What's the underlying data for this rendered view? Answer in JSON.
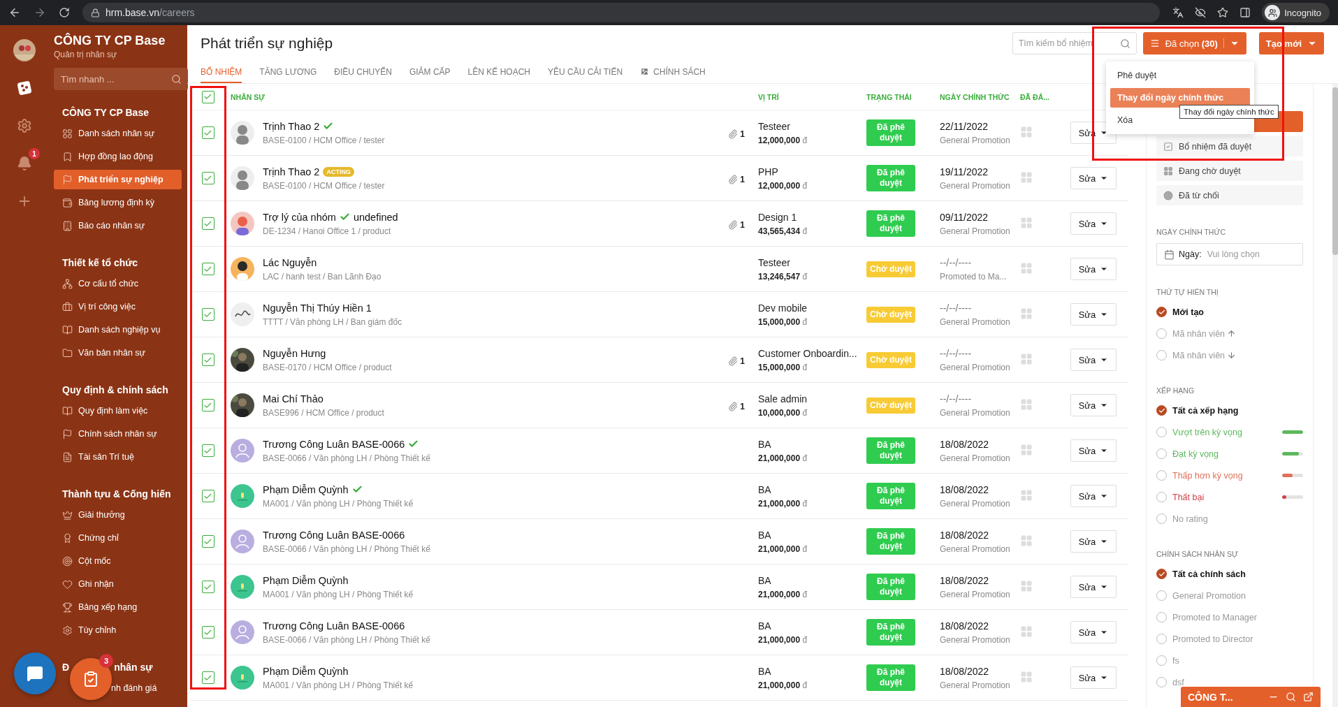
{
  "browser": {
    "url_host": "hrm.base.vn",
    "url_path": "/careers",
    "profile": "Incognito"
  },
  "rail": {
    "notification_count": "1"
  },
  "sidebar": {
    "company": "CÔNG TY CP Base",
    "subtitle": "Quản trị nhân sự",
    "search": {
      "placeholder": "Tìm nhanh ..."
    },
    "sections": [
      {
        "title": "CÔNG TY CP Base",
        "items": [
          {
            "label": "Danh sách nhân sự",
            "selected": false
          },
          {
            "label": "Hợp đồng lao động",
            "selected": false
          },
          {
            "label": "Phát triển sự nghiệp",
            "selected": true
          },
          {
            "label": "Bảng lương định kỳ",
            "selected": false
          },
          {
            "label": "Báo cáo nhân sự",
            "selected": false
          }
        ]
      },
      {
        "title": "Thiết kế tổ chức",
        "items": [
          {
            "label": "Cơ cấu tổ chức",
            "selected": false
          },
          {
            "label": "Vị trí công việc",
            "selected": false
          },
          {
            "label": "Danh sách nghiệp vụ",
            "selected": false
          },
          {
            "label": "Văn bản nhân sự",
            "selected": false
          }
        ]
      },
      {
        "title": "Quy định & chính sách",
        "items": [
          {
            "label": "Quy định làm việc",
            "selected": false
          },
          {
            "label": "Chính sách nhân sự",
            "selected": false
          },
          {
            "label": "Tài sản Trí tuệ",
            "selected": false
          }
        ]
      },
      {
        "title": "Thành tựu & Cống hiến",
        "items": [
          {
            "label": "Giải thưởng",
            "selected": false
          },
          {
            "label": "Chứng chỉ",
            "selected": false
          },
          {
            "label": "Cột mốc",
            "selected": false
          },
          {
            "label": "Ghi nhận",
            "selected": false
          },
          {
            "label": "Bảng xếp hạng",
            "selected": false
          },
          {
            "label": "Tùy chỉnh",
            "selected": false
          }
        ]
      },
      {
        "title": "Đ",
        "title_tail": "nhân sự",
        "items": [
          {
            "label": "nh đánh giá",
            "selected": false
          }
        ]
      }
    ]
  },
  "floating": {
    "task_count": "3"
  },
  "page": {
    "title": "Phát triển sự nghiệp",
    "search": {
      "placeholder": "Tìm kiếm bổ nhiệm"
    },
    "selected_button": "Đã chọn **(30)**",
    "create_button": "Tạo mới"
  },
  "tabs": [
    {
      "label": "BỔ NHIỆM",
      "selected": true,
      "kind": "text"
    },
    {
      "label": "TĂNG LƯƠNG",
      "selected": false,
      "kind": "text"
    },
    {
      "label": "ĐIỀU CHUYỂN",
      "selected": false,
      "kind": "text"
    },
    {
      "label": "GIẢM CẤP",
      "selected": false,
      "kind": "text"
    },
    {
      "label": "LÊN KẾ HOẠCH",
      "selected": false,
      "kind": "text"
    },
    {
      "label": "YÊU CẦU CẢI TIẾN",
      "selected": false,
      "kind": "text"
    },
    {
      "label": "CHÍNH SÁCH",
      "selected": false,
      "kind": "icon"
    }
  ],
  "dropdown": {
    "items": [
      {
        "label": "Phê duyệt",
        "selected": false
      },
      {
        "label": "Thay đổi ngày chính thức",
        "selected": true
      },
      {
        "label": "Xóa",
        "selected": false
      }
    ],
    "tooltip": "Thay đổi ngày chính thức"
  },
  "table": {
    "all_checked": true,
    "columns": [
      "NHÂN SỰ",
      "VỊ TRÍ",
      "TRẠNG THÁI",
      "NGÀY CHÍNH THỨC",
      "ĐÃ ĐÁ..."
    ],
    "rows": [
      {
        "checked": true,
        "avatar": {
          "kind": "silhouette"
        },
        "name": "Trịnh Thao 2",
        "verified": true,
        "details": "BASE-0100 / HCM Office / tester",
        "attachments": "1",
        "position": "Testeer",
        "salary": "12,000,000",
        "currency": "đ",
        "status": {
          "kind": "approved",
          "label": "Đã phê duyệt"
        },
        "date": "22/11/2022",
        "policy": "General Promotion",
        "action": "Sửa"
      },
      {
        "checked": true,
        "avatar": {
          "kind": "silhouette"
        },
        "name": "Trịnh Thao 2",
        "verified": false,
        "badge": "ACTING",
        "details": "BASE-0100 / HCM Office / tester",
        "attachments": "1",
        "position": "PHP",
        "salary": "12,000,000",
        "currency": "đ",
        "status": {
          "kind": "approved",
          "label": "Đã phê duyệt"
        },
        "date": "19/11/2022",
        "policy": "General Promotion",
        "action": "Sửa"
      },
      {
        "checked": true,
        "avatar": {
          "kind": "illustration"
        },
        "name": "Trợ lý của nhóm",
        "verified": true,
        "suffix": "undefined",
        "details": "DE-1234 / Hanoi Office 1 / product",
        "attachments": "1",
        "position": "Design 1",
        "salary": "43,565,434",
        "currency": "đ",
        "status": {
          "kind": "approved",
          "label": "Đã phê duyệt"
        },
        "date": "09/11/2022",
        "policy": "General Promotion",
        "action": "Sửa"
      },
      {
        "checked": true,
        "avatar": {
          "kind": "cartoon"
        },
        "name": "Lác Nguyễn",
        "verified": false,
        "details": "LAC / hanh test / Ban Lãnh Đạo",
        "position": "Testeer",
        "salary": "13,246,547",
        "currency": "đ",
        "status": {
          "kind": "pending",
          "label": "Chờ duyệt"
        },
        "date": "--/--/----",
        "policy": "Promoted to Ma...",
        "action": "Sửa"
      },
      {
        "checked": true,
        "avatar": {
          "kind": "signature"
        },
        "name": "Nguyễn Thị Thúy Hiền 1",
        "verified": false,
        "details": "TTTT / Văn phòng LH / Ban giám đốc",
        "position": "Dev mobile",
        "salary": "15,000,000",
        "currency": "đ",
        "status": {
          "kind": "pending",
          "label": "Chờ duyệt"
        },
        "date": "--/--/----",
        "policy": "General Promotion",
        "action": "Sửa"
      },
      {
        "checked": true,
        "name": "Nguyễn Hưng",
        "verified": false,
        "details": "BASE-0170 / HCM Office / product",
        "attachments": "1",
        "position": "Customer Onboardin...",
        "salary": "15,000,000",
        "currency": "đ",
        "status": {
          "kind": "pending",
          "label": "Chờ duyệt"
        },
        "date": "--/--/----",
        "policy": "General Promotion",
        "action": "Sửa"
      },
      {
        "checked": true,
        "name": "Mai Chí Thảo",
        "verified": false,
        "details": "BASE996 / HCM Office / product",
        "attachments": "1",
        "position": "Sale admin",
        "salary": "10,000,000",
        "currency": "đ",
        "status": {
          "kind": "pending",
          "label": "Chờ duyệt"
        },
        "date": "--/--/----",
        "policy": "General Promotion",
        "action": "Sửa"
      },
      {
        "checked": true,
        "avatar": {
          "kind": "placeholder"
        },
        "name": "Trương Công Luân BASE-0066",
        "verified": true,
        "details": "BASE-0066 / Văn phòng LH / Phòng Thiết kế",
        "position": "BA",
        "salary": "21,000,000",
        "currency": "đ",
        "status": {
          "kind": "approved",
          "label": "Đã phê duyệt"
        },
        "date": "18/08/2022",
        "policy": "General Promotion",
        "action": "Sửa"
      },
      {
        "checked": true,
        "avatar": {
          "kind": "logo"
        },
        "name": "Phạm Diễm Quỳnh",
        "verified": true,
        "details": "MA001 / Văn phòng LH / Phòng Thiết kế",
        "position": "BA",
        "salary": "21,000,000",
        "currency": "đ",
        "status": {
          "kind": "approved",
          "label": "Đã phê duyệt"
        },
        "date": "18/08/2022",
        "policy": "General Promotion",
        "action": "Sửa"
      },
      {
        "checked": true,
        "avatar": {
          "kind": "placeholder"
        },
        "name": "Trương Công Luân BASE-0066",
        "verified": false,
        "details": "BASE-0066 / Văn phòng LH / Phòng Thiết kế",
        "position": "BA",
        "salary": "21,000,000",
        "currency": "đ",
        "status": {
          "kind": "approved",
          "label": "Đã phê duyệt"
        },
        "date": "18/08/2022",
        "policy": "General Promotion",
        "action": "Sửa"
      },
      {
        "checked": true,
        "avatar": {
          "kind": "logo"
        },
        "name": "Phạm Diễm Quỳnh",
        "verified": false,
        "details": "MA001 / Văn phòng LH / Phòng Thiết kế",
        "position": "BA",
        "salary": "21,000,000",
        "currency": "đ",
        "status": {
          "kind": "approved",
          "label": "Đã phê duyệt"
        },
        "date": "18/08/2022",
        "policy": "General Promotion",
        "action": "Sửa"
      },
      {
        "checked": true,
        "avatar": {
          "kind": "placeholder"
        },
        "name": "Trương Công Luân BASE-0066",
        "verified": false,
        "details": "BASE-0066 / Văn phòng LH / Phòng Thiết kế",
        "position": "BA",
        "salary": "21,000,000",
        "currency": "đ",
        "status": {
          "kind": "approved",
          "label": "Đã phê duyệt"
        },
        "date": "18/08/2022",
        "policy": "General Promotion",
        "action": "Sửa"
      },
      {
        "checked": true,
        "avatar": {
          "kind": "logo"
        },
        "name": "Phạm Diễm Quỳnh",
        "verified": false,
        "details": "MA001 / Văn phòng LH / Phòng Thiết kế",
        "position": "BA",
        "salary": "21,000,000",
        "currency": "đ",
        "status": {
          "kind": "approved",
          "label": "Đã phê duyệt"
        },
        "date": "18/08/2022",
        "policy": "General Promotion",
        "action": "Sửa"
      }
    ]
  },
  "filters": {
    "status_items": [
      {
        "label": "Bổ nhiệm đã duyệt",
        "kind": "approved"
      },
      {
        "label": "Đang chờ duyệt",
        "kind": "pending"
      },
      {
        "label": "Đã từ chối",
        "kind": "rejected"
      }
    ],
    "date": {
      "title": "NGÀY CHÍNH THỨC",
      "label": "Ngày:",
      "placeholder": "Vui lòng chọn"
    },
    "order": {
      "title": "THỨ TỰ HIỂN THỊ",
      "options": [
        {
          "label": "Mới tạo",
          "selected": true,
          "kind": "plain"
        },
        {
          "label": "Mã nhân viên",
          "selected": false,
          "kind": "ascending"
        },
        {
          "label": "Mã nhân viên",
          "selected": false,
          "kind": "descending"
        }
      ]
    },
    "rating": {
      "title": "XẾP HẠNG",
      "options": [
        {
          "label": "Tất cả xếp hạng",
          "selected": true
        },
        {
          "label": "Vượt trên kỳ vọng",
          "selected": false,
          "color": "#5cb85c",
          "level": 1
        },
        {
          "label": "Đạt kỳ vọng",
          "selected": false,
          "color": "#5cb85c",
          "level": 0.8
        },
        {
          "label": "Thấp hơn kỳ vọng",
          "selected": false,
          "color": "#e0705a",
          "level": 0.5
        },
        {
          "label": "Thất bại",
          "selected": false,
          "color": "#d0404a",
          "level": 0.2
        },
        {
          "label": "No rating",
          "selected": false
        }
      ]
    },
    "policy": {
      "title": "CHÍNH SÁCH NHÂN SỰ",
      "options": [
        {
          "label": "Tất cả chính sách",
          "selected": true
        },
        {
          "label": "General Promotion",
          "selected": false
        },
        {
          "label": "Promoted to Manager",
          "selected": false
        },
        {
          "label": "Promoted to Director",
          "selected": false
        },
        {
          "label": "fs",
          "selected": false
        },
        {
          "label": "dsf",
          "selected": false
        }
      ]
    }
  },
  "chat_widget": {
    "title": "CÔNG T..."
  }
}
